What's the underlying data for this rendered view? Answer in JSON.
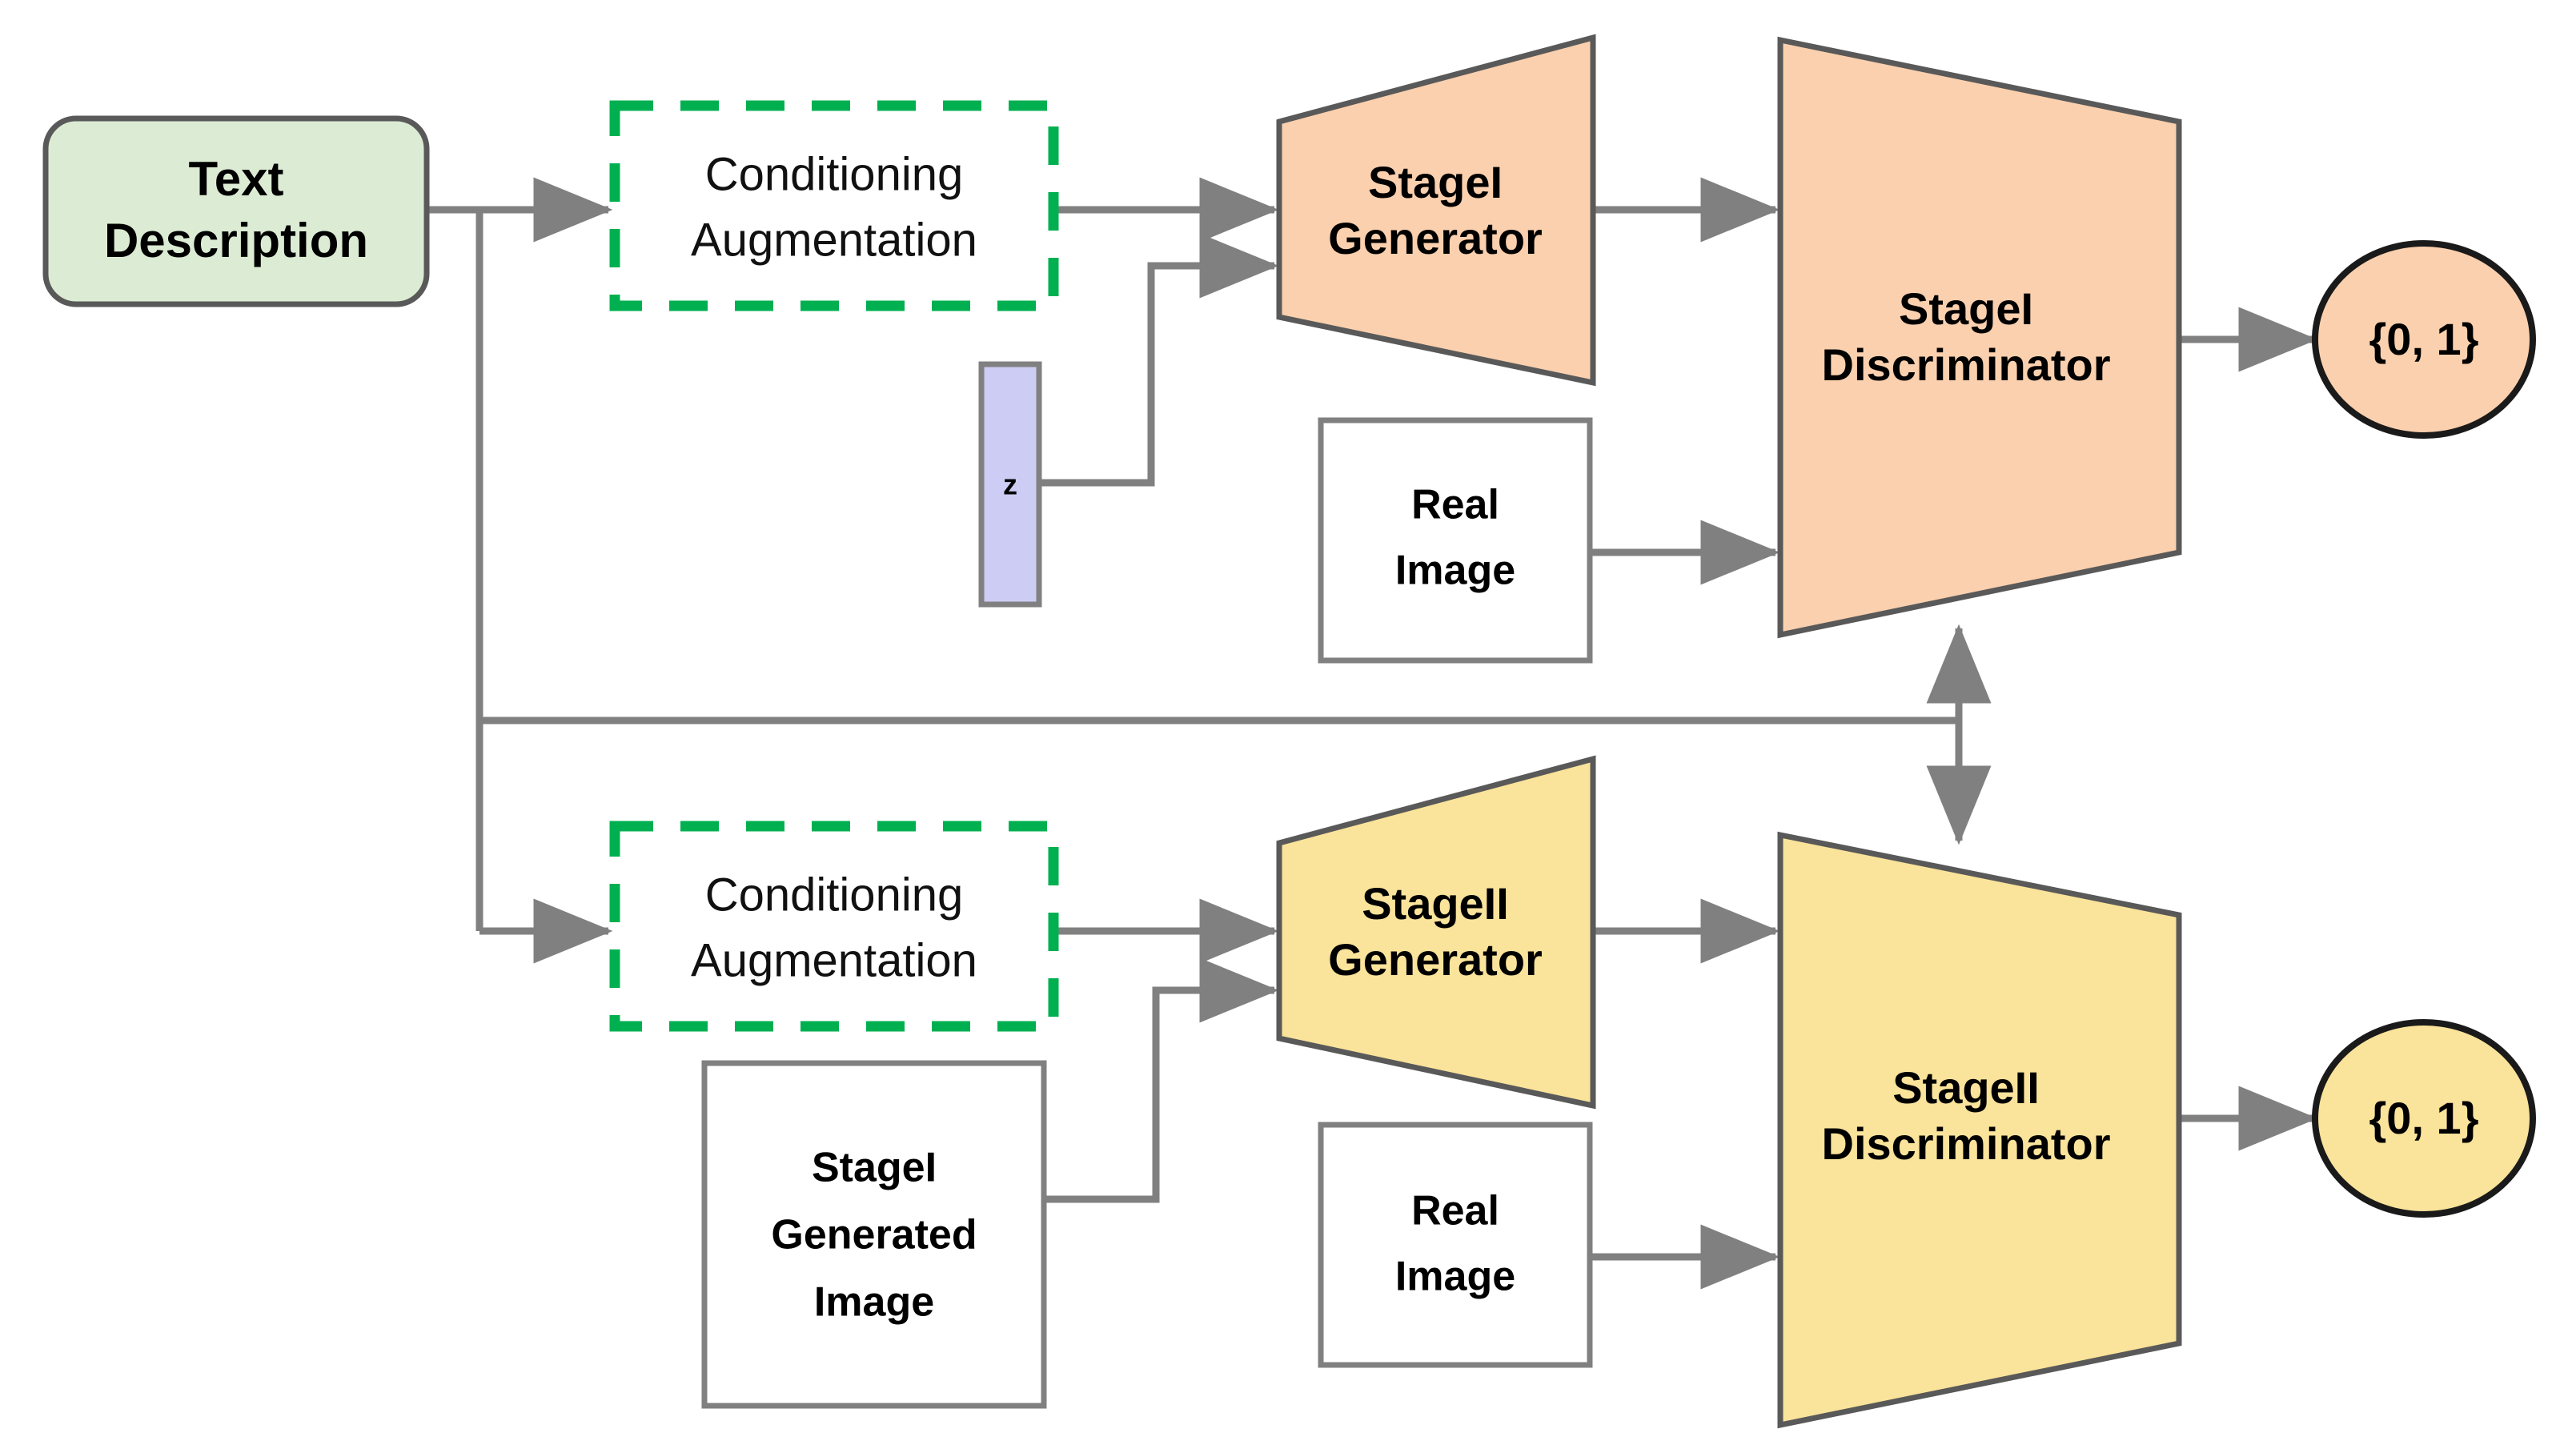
{
  "diagram": {
    "title": "StackGAN two-stage text-to-image architecture",
    "colors": {
      "peach_fill": "#fbd0ae",
      "yellow_fill": "#fae39a",
      "green_fill": "#dcecd4",
      "lavender_fill": "#ccccf5",
      "white_fill": "#ffffff",
      "shape_border": "#808080",
      "dark_border": "#595959",
      "circle_border": "#1a1a1a",
      "dashed_green": "#00b050",
      "edge_gray": "#808080",
      "text": "#000000"
    },
    "nodes": {
      "text_description": {
        "label_line1": "Text",
        "label_line2": "Description"
      },
      "conditioning_augmentation_1": {
        "label_line1": "Conditioning",
        "label_line2": "Augmentation"
      },
      "conditioning_augmentation_2": {
        "label_line1": "Conditioning",
        "label_line2": "Augmentation"
      },
      "noise_z": {
        "label": "z"
      },
      "stage1_generator": {
        "label_line1": "StageI",
        "label_line2": "Generator"
      },
      "stage1_discriminator": {
        "label_line1": "StageI",
        "label_line2": "Discriminator"
      },
      "stage1_real_image": {
        "label_line1": "Real",
        "label_line2": "Image"
      },
      "stage1_output": {
        "label": "{0, 1}"
      },
      "stage2_generator": {
        "label_line1": "StageII",
        "label_line2": "Generator"
      },
      "stage2_discriminator": {
        "label_line1": "StageII",
        "label_line2": "Discriminator"
      },
      "stage1_generated_image": {
        "label_line1": "StageI",
        "label_line2": "Generated",
        "label_line3": "Image"
      },
      "stage2_real_image": {
        "label_line1": "Real",
        "label_line2": "Image"
      },
      "stage2_output": {
        "label": "{0, 1}"
      }
    }
  }
}
